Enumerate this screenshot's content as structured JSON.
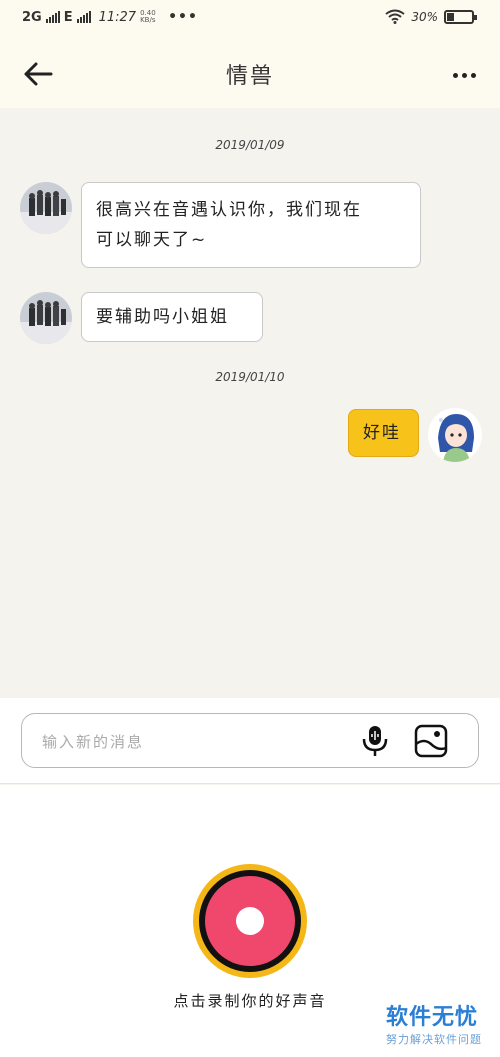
{
  "status_bar": {
    "network": "2G",
    "network_type": "E",
    "time": "11:27",
    "net_speed_value": "0.40",
    "net_speed_unit": "KB/s",
    "more": "•••",
    "battery_text": "30%",
    "battery_level": 0.3
  },
  "header": {
    "title": "情兽"
  },
  "chat": {
    "messages": [
      {
        "type": "date",
        "text": "2019/01/09"
      },
      {
        "type": "received",
        "line1": "很高兴在音遇认识你，我们现在",
        "line2": "可以聊天了~"
      },
      {
        "type": "received",
        "text": "要辅助吗小姐姐"
      },
      {
        "type": "date",
        "text": "2019/01/10"
      },
      {
        "type": "sent",
        "text": "好哇"
      }
    ]
  },
  "input": {
    "placeholder": "输入新的消息"
  },
  "record": {
    "hint": "点击录制你的好声音"
  },
  "watermark": {
    "main": "软件无忧",
    "sub": "努力解决软件问题"
  },
  "colors": {
    "accent": "#f7c21a",
    "record_outer": "#f5b718",
    "record_core": "#f0476d",
    "background": "#f4f3ee",
    "header_bg": "#fdfaf0",
    "watermark": "#2a7fd4"
  },
  "icons": {
    "back": "arrow-left-icon",
    "more": "more-dots-icon",
    "mic": "microphone-icon",
    "image": "image-icon",
    "wifi": "wifi-icon",
    "battery": "battery-icon",
    "signal": "signal-icon"
  }
}
